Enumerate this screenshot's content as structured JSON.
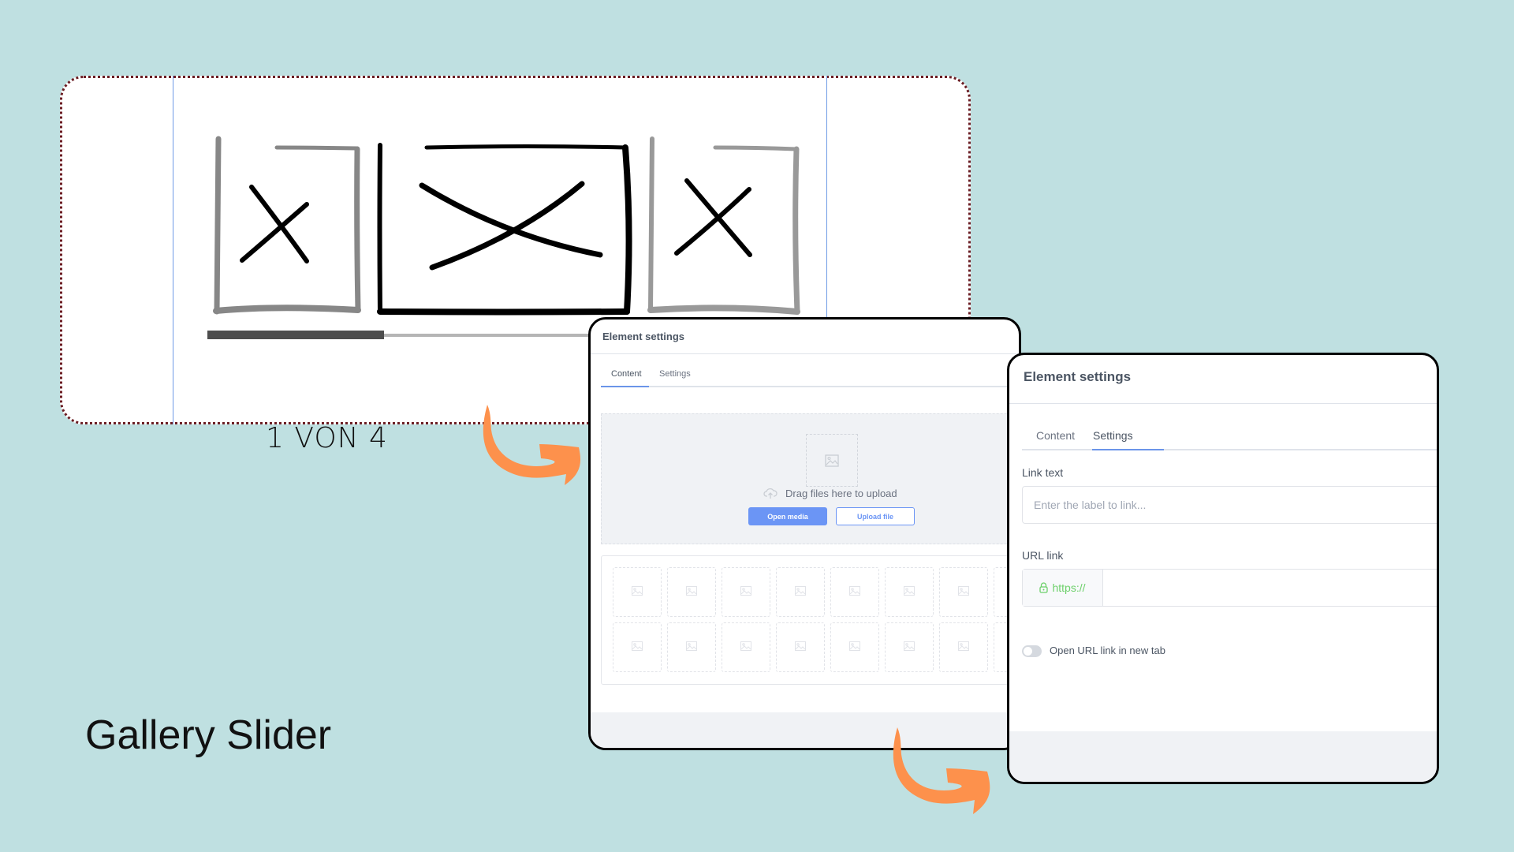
{
  "slide": {
    "title": "Gallery Slider"
  },
  "sketch": {
    "caption": "1 VON 4",
    "current_slide": 1,
    "total_slides": 4,
    "progress_fraction": 0.25,
    "slides": [
      {
        "kind": "image-placeholder",
        "style": "inactive"
      },
      {
        "kind": "image-placeholder",
        "style": "active"
      },
      {
        "kind": "image-placeholder",
        "style": "inactive"
      }
    ]
  },
  "content_panel": {
    "title": "Element settings",
    "tabs": [
      {
        "label": "Content",
        "active": true
      },
      {
        "label": "Settings",
        "active": false
      }
    ],
    "upload": {
      "drag_text": "Drag files here to upload",
      "open_media_label": "Open media",
      "upload_file_label": "Upload file"
    },
    "grid": {
      "rows": 2,
      "visible_columns": 8
    }
  },
  "settings_panel": {
    "title": "Element settings",
    "tabs": [
      {
        "label": "Content",
        "active": false
      },
      {
        "label": "Settings",
        "active": true
      }
    ],
    "link_text": {
      "label": "Link text",
      "placeholder": "Enter the label to link...",
      "value": ""
    },
    "url_link": {
      "label": "URL link",
      "prefix": "https://",
      "value": ""
    },
    "open_new_tab": {
      "label": "Open URL link in new tab",
      "checked": false
    }
  },
  "colors": {
    "background": "#bfe0e1",
    "accent": "#6b95f5",
    "arrow": "#fd914c",
    "secure_prefix": "#6cd06a",
    "dotted_border": "#6b1e24"
  }
}
